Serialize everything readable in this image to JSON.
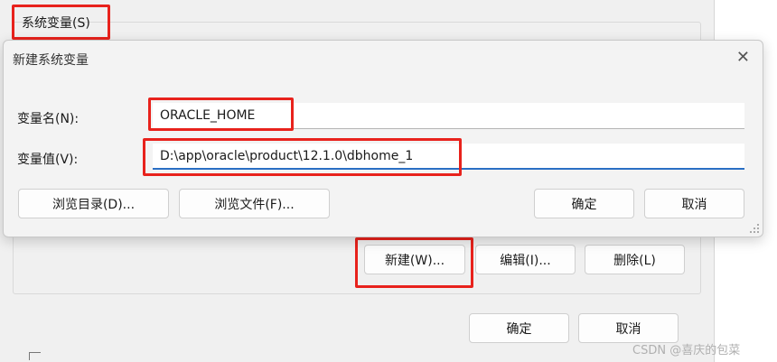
{
  "background": {
    "group_label": "系统变量(S)",
    "buttons": {
      "new": "新建(W)...",
      "edit": "编辑(I)...",
      "delete": "删除(L)"
    },
    "ok": "确定",
    "cancel": "取消"
  },
  "dialog": {
    "title": "新建系统变量",
    "close_icon": "close-icon",
    "name_label": "变量名(N):",
    "name_value": "ORACLE_HOME",
    "value_label": "变量值(V):",
    "value_value": "D:\\app\\oracle\\product\\12.1.0\\dbhome_1",
    "browse_dir": "浏览目录(D)...",
    "browse_file": "浏览文件(F)...",
    "ok": "确定",
    "cancel": "取消"
  },
  "watermark": "CSDN @喜庆的包菜",
  "colors": {
    "highlight": "#e8221c",
    "focus": "#2a6fc4"
  }
}
